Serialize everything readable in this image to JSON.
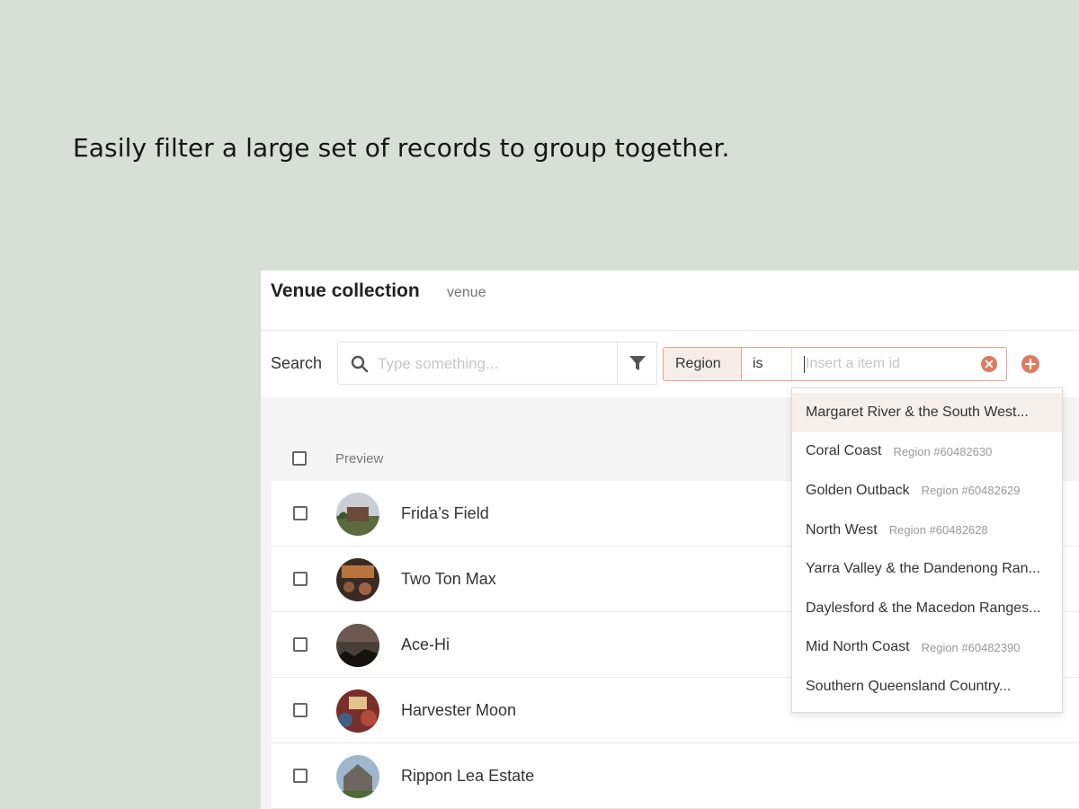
{
  "headline": "Easily filter a large set of records to group together.",
  "panel": {
    "title": "Venue collection",
    "subtitle": "venue"
  },
  "search": {
    "label": "Search",
    "placeholder": "Type something..."
  },
  "filter": {
    "field": "Region",
    "operator": "is",
    "value_placeholder": "Insert a item id"
  },
  "list": {
    "column_preview": "Preview",
    "rows": [
      {
        "name": "Frida’s Field"
      },
      {
        "name": "Two Ton Max"
      },
      {
        "name": "Ace-Hi"
      },
      {
        "name": "Harvester Moon"
      },
      {
        "name": "Rippon Lea Estate"
      }
    ]
  },
  "dropdown": {
    "options": [
      {
        "label": "Margaret River & the South West...",
        "meta": ""
      },
      {
        "label": "Coral Coast",
        "meta": "Region #60482630"
      },
      {
        "label": "Golden Outback",
        "meta": "Region #60482629"
      },
      {
        "label": "North West",
        "meta": "Region #60482628"
      },
      {
        "label": "Yarra Valley & the Dandenong Ran...",
        "meta": ""
      },
      {
        "label": "Daylesford & the Macedon Ranges...",
        "meta": ""
      },
      {
        "label": "Mid North Coast",
        "meta": "Region #60482390"
      },
      {
        "label": "Southern Queensland Country...",
        "meta": ""
      }
    ]
  },
  "colors": {
    "background": "#d8dfd6",
    "accent": "#e07a5f",
    "filter_highlight": "#f6ede9"
  }
}
